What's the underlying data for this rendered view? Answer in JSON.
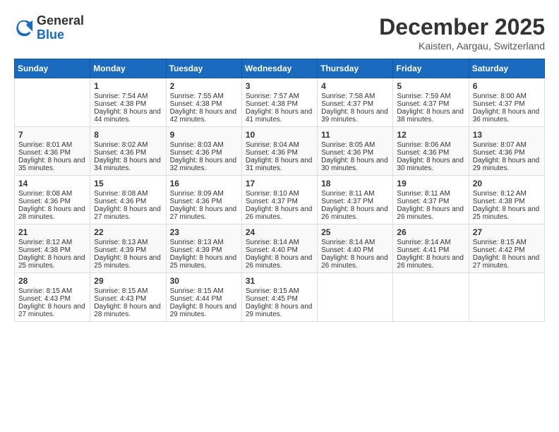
{
  "header": {
    "logo_general": "General",
    "logo_blue": "Blue",
    "month_title": "December 2025",
    "location": "Kaisten, Aargau, Switzerland"
  },
  "days_of_week": [
    "Sunday",
    "Monday",
    "Tuesday",
    "Wednesday",
    "Thursday",
    "Friday",
    "Saturday"
  ],
  "weeks": [
    [
      {
        "day": "",
        "sunrise": "",
        "sunset": "",
        "daylight": ""
      },
      {
        "day": "1",
        "sunrise": "Sunrise: 7:54 AM",
        "sunset": "Sunset: 4:38 PM",
        "daylight": "Daylight: 8 hours and 44 minutes."
      },
      {
        "day": "2",
        "sunrise": "Sunrise: 7:55 AM",
        "sunset": "Sunset: 4:38 PM",
        "daylight": "Daylight: 8 hours and 42 minutes."
      },
      {
        "day": "3",
        "sunrise": "Sunrise: 7:57 AM",
        "sunset": "Sunset: 4:38 PM",
        "daylight": "Daylight: 8 hours and 41 minutes."
      },
      {
        "day": "4",
        "sunrise": "Sunrise: 7:58 AM",
        "sunset": "Sunset: 4:37 PM",
        "daylight": "Daylight: 8 hours and 39 minutes."
      },
      {
        "day": "5",
        "sunrise": "Sunrise: 7:59 AM",
        "sunset": "Sunset: 4:37 PM",
        "daylight": "Daylight: 8 hours and 38 minutes."
      },
      {
        "day": "6",
        "sunrise": "Sunrise: 8:00 AM",
        "sunset": "Sunset: 4:37 PM",
        "daylight": "Daylight: 8 hours and 36 minutes."
      }
    ],
    [
      {
        "day": "7",
        "sunrise": "Sunrise: 8:01 AM",
        "sunset": "Sunset: 4:36 PM",
        "daylight": "Daylight: 8 hours and 35 minutes."
      },
      {
        "day": "8",
        "sunrise": "Sunrise: 8:02 AM",
        "sunset": "Sunset: 4:36 PM",
        "daylight": "Daylight: 8 hours and 34 minutes."
      },
      {
        "day": "9",
        "sunrise": "Sunrise: 8:03 AM",
        "sunset": "Sunset: 4:36 PM",
        "daylight": "Daylight: 8 hours and 32 minutes."
      },
      {
        "day": "10",
        "sunrise": "Sunrise: 8:04 AM",
        "sunset": "Sunset: 4:36 PM",
        "daylight": "Daylight: 8 hours and 31 minutes."
      },
      {
        "day": "11",
        "sunrise": "Sunrise: 8:05 AM",
        "sunset": "Sunset: 4:36 PM",
        "daylight": "Daylight: 8 hours and 30 minutes."
      },
      {
        "day": "12",
        "sunrise": "Sunrise: 8:06 AM",
        "sunset": "Sunset: 4:36 PM",
        "daylight": "Daylight: 8 hours and 30 minutes."
      },
      {
        "day": "13",
        "sunrise": "Sunrise: 8:07 AM",
        "sunset": "Sunset: 4:36 PM",
        "daylight": "Daylight: 8 hours and 29 minutes."
      }
    ],
    [
      {
        "day": "14",
        "sunrise": "Sunrise: 8:08 AM",
        "sunset": "Sunset: 4:36 PM",
        "daylight": "Daylight: 8 hours and 28 minutes."
      },
      {
        "day": "15",
        "sunrise": "Sunrise: 8:08 AM",
        "sunset": "Sunset: 4:36 PM",
        "daylight": "Daylight: 8 hours and 27 minutes."
      },
      {
        "day": "16",
        "sunrise": "Sunrise: 8:09 AM",
        "sunset": "Sunset: 4:36 PM",
        "daylight": "Daylight: 8 hours and 27 minutes."
      },
      {
        "day": "17",
        "sunrise": "Sunrise: 8:10 AM",
        "sunset": "Sunset: 4:37 PM",
        "daylight": "Daylight: 8 hours and 26 minutes."
      },
      {
        "day": "18",
        "sunrise": "Sunrise: 8:11 AM",
        "sunset": "Sunset: 4:37 PM",
        "daylight": "Daylight: 8 hours and 26 minutes."
      },
      {
        "day": "19",
        "sunrise": "Sunrise: 8:11 AM",
        "sunset": "Sunset: 4:37 PM",
        "daylight": "Daylight: 8 hours and 26 minutes."
      },
      {
        "day": "20",
        "sunrise": "Sunrise: 8:12 AM",
        "sunset": "Sunset: 4:38 PM",
        "daylight": "Daylight: 8 hours and 25 minutes."
      }
    ],
    [
      {
        "day": "21",
        "sunrise": "Sunrise: 8:12 AM",
        "sunset": "Sunset: 4:38 PM",
        "daylight": "Daylight: 8 hours and 25 minutes."
      },
      {
        "day": "22",
        "sunrise": "Sunrise: 8:13 AM",
        "sunset": "Sunset: 4:39 PM",
        "daylight": "Daylight: 8 hours and 25 minutes."
      },
      {
        "day": "23",
        "sunrise": "Sunrise: 8:13 AM",
        "sunset": "Sunset: 4:39 PM",
        "daylight": "Daylight: 8 hours and 25 minutes."
      },
      {
        "day": "24",
        "sunrise": "Sunrise: 8:14 AM",
        "sunset": "Sunset: 4:40 PM",
        "daylight": "Daylight: 8 hours and 26 minutes."
      },
      {
        "day": "25",
        "sunrise": "Sunrise: 8:14 AM",
        "sunset": "Sunset: 4:40 PM",
        "daylight": "Daylight: 8 hours and 26 minutes."
      },
      {
        "day": "26",
        "sunrise": "Sunrise: 8:14 AM",
        "sunset": "Sunset: 4:41 PM",
        "daylight": "Daylight: 8 hours and 26 minutes."
      },
      {
        "day": "27",
        "sunrise": "Sunrise: 8:15 AM",
        "sunset": "Sunset: 4:42 PM",
        "daylight": "Daylight: 8 hours and 27 minutes."
      }
    ],
    [
      {
        "day": "28",
        "sunrise": "Sunrise: 8:15 AM",
        "sunset": "Sunset: 4:43 PM",
        "daylight": "Daylight: 8 hours and 27 minutes."
      },
      {
        "day": "29",
        "sunrise": "Sunrise: 8:15 AM",
        "sunset": "Sunset: 4:43 PM",
        "daylight": "Daylight: 8 hours and 28 minutes."
      },
      {
        "day": "30",
        "sunrise": "Sunrise: 8:15 AM",
        "sunset": "Sunset: 4:44 PM",
        "daylight": "Daylight: 8 hours and 29 minutes."
      },
      {
        "day": "31",
        "sunrise": "Sunrise: 8:15 AM",
        "sunset": "Sunset: 4:45 PM",
        "daylight": "Daylight: 8 hours and 29 minutes."
      },
      {
        "day": "",
        "sunrise": "",
        "sunset": "",
        "daylight": ""
      },
      {
        "day": "",
        "sunrise": "",
        "sunset": "",
        "daylight": ""
      },
      {
        "day": "",
        "sunrise": "",
        "sunset": "",
        "daylight": ""
      }
    ]
  ]
}
